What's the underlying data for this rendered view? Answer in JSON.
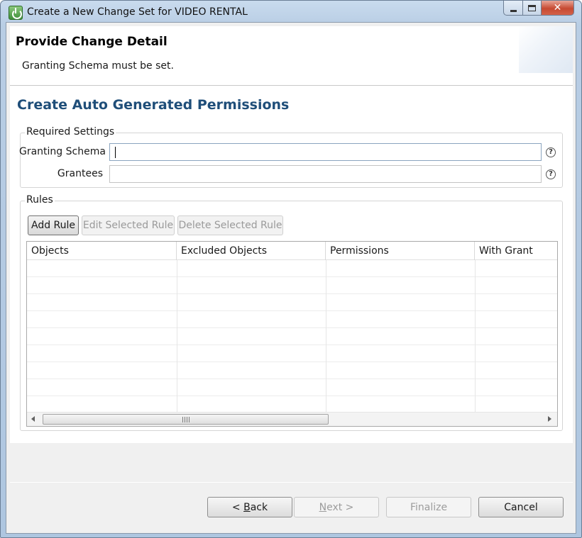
{
  "window": {
    "title": "Create a New Change Set for VIDEO RENTAL",
    "controls": {
      "minimize_icon": "minimize-icon",
      "maximize_icon": "maximize-icon",
      "close_glyph": "✕"
    }
  },
  "header": {
    "title": "Provide Change Detail",
    "message": "Granting Schema must be set."
  },
  "page": {
    "title": "Create Auto Generated Permissions"
  },
  "required_settings": {
    "group_label": "Required Settings",
    "granting_schema": {
      "label": "Granting Schema",
      "value": "",
      "help": "?"
    },
    "grantees": {
      "label": "Grantees",
      "value": "",
      "help": "?"
    }
  },
  "rules": {
    "group_label": "Rules",
    "buttons": {
      "add": "Add Rule",
      "edit": "Edit Selected Rule",
      "delete": "Delete Selected Rule"
    },
    "table": {
      "columns": [
        "Objects",
        "Excluded Objects",
        "Permissions",
        "With Grant"
      ],
      "rows": []
    },
    "scrollbar_grip": "III"
  },
  "wizard": {
    "back_prefix": "< ",
    "back_mnemonic": "B",
    "back_rest": "ack",
    "next_mnemonic": "N",
    "next_rest": "ext >",
    "finalize": "Finalize",
    "cancel": "Cancel"
  }
}
